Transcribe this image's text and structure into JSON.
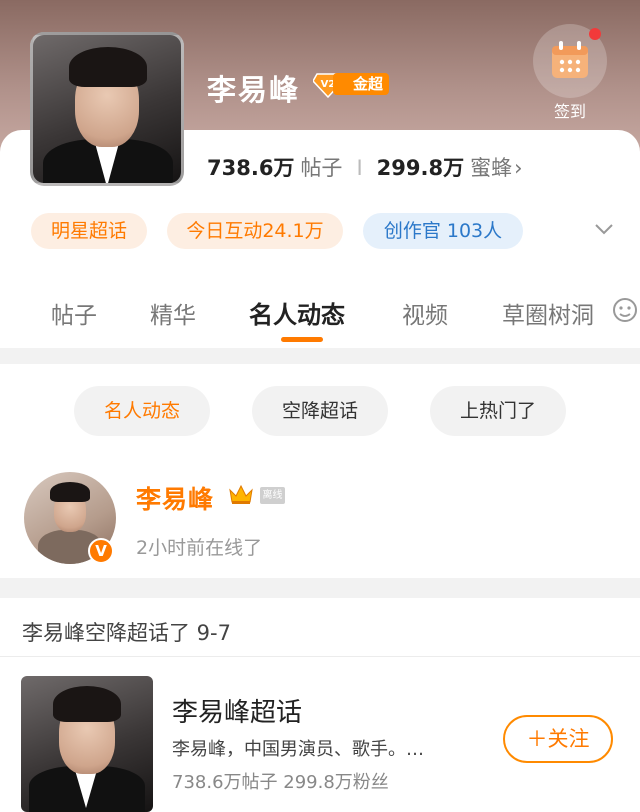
{
  "header": {
    "name": "李易峰",
    "level_badge": "金超",
    "signin_label": "签到",
    "posts_count": "738.6万",
    "posts_label": "帖子",
    "fans_count": "299.8万",
    "fans_label": "蜜蜂",
    "fans_arrow": "›"
  },
  "tags": [
    {
      "label": "明星超话"
    },
    {
      "label": "今日互动24.1万"
    },
    {
      "label": "创作官 103人"
    }
  ],
  "tabs": [
    "帖子",
    "精华",
    "名人动态",
    "视频",
    "草圈树洞"
  ],
  "active_tab": "名人动态",
  "filters": [
    "名人动态",
    "空降超话",
    "上热门了"
  ],
  "celebrity": {
    "name": "李易峰",
    "offline_badge": "离线",
    "verified_badge": "V",
    "status_text": "2小时前在线了"
  },
  "section": {
    "title": "李易峰空降超话了 9-7"
  },
  "result": {
    "title": "李易峰超话",
    "description": "李易峰，中国男演员、歌手。…",
    "stats": "738.6万帖子  299.8万粉丝",
    "follow_label": "＋关注"
  },
  "colors": {
    "accent": "#ff7a00",
    "badge": "#ff8a00",
    "tag_orange_bg": "#fdeee2",
    "tag_blue_bg": "#e5f0fb",
    "tag_blue_text": "#2b78c9",
    "notify_dot": "#f23a3a"
  }
}
